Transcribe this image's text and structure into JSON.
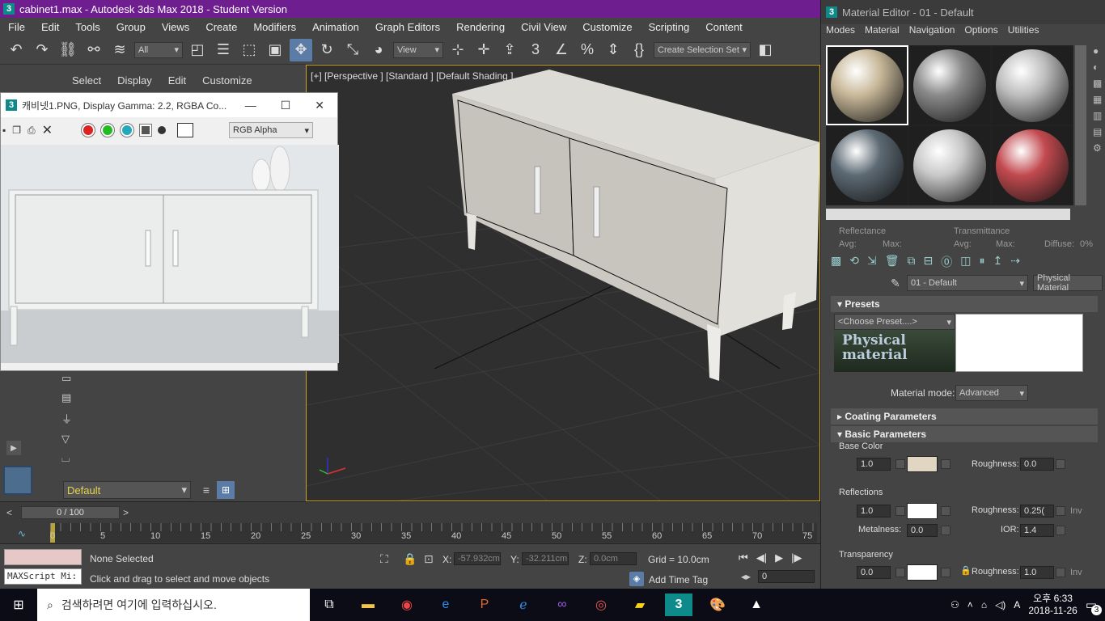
{
  "window": {
    "title": "cabinet1.max - Autodesk 3ds Max 2018 - Student Version"
  },
  "menubar": [
    "File",
    "Edit",
    "Tools",
    "Group",
    "Views",
    "Create",
    "Modifiers",
    "Animation",
    "Graph Editors",
    "Rendering",
    "Civil View",
    "Customize",
    "Scripting",
    "Content"
  ],
  "toolbar": {
    "filter": "All",
    "view": "View",
    "selection_set": "Create Selection Set"
  },
  "cmd_tabs": [
    "Select",
    "Display",
    "Edit",
    "Customize"
  ],
  "image_window": {
    "title": "캐비넷1.PNG, Display Gamma: 2.2, RGBA Co...",
    "channel": "RGB Alpha"
  },
  "viewport": {
    "label": "[+] [Perspective ] [Standard ] [Default Shading ]"
  },
  "layer": {
    "name": "Default"
  },
  "timeline": {
    "frame": "0 / 100",
    "ticks": [
      "0",
      "5",
      "10",
      "15",
      "20",
      "25",
      "30",
      "35",
      "40",
      "45",
      "50",
      "55",
      "60",
      "65",
      "70",
      "75"
    ]
  },
  "status": {
    "selection": "None Selected",
    "hint": "Click and drag to select and move objects",
    "maxscript": "MAXScript Mi:",
    "x_label": "X:",
    "x": "-57.932cm",
    "y_label": "Y:",
    "y": "-32.211cm",
    "z_label": "Z:",
    "z": "0.0cm",
    "grid": "Grid = 10.0cm",
    "add_time_tag": "Add Time Tag",
    "frame_field": "0"
  },
  "material_editor": {
    "title": "Material Editor - 01 - Default",
    "menu": [
      "Modes",
      "Material",
      "Navigation",
      "Options",
      "Utilities"
    ],
    "spheres": [
      "#c9b99a",
      "#8a8a8a",
      "#bdbdbd",
      "#5d6a74",
      "#c8c8c8",
      "#c24a4f"
    ],
    "reflectance": "Reflectance",
    "transmittance": "Transmittance",
    "avg": "Avg:",
    "max": "Max:",
    "diffuse": "Diffuse:",
    "diffuse_val": "0%",
    "material_name": "01 - Default",
    "material_type": "Physical Material",
    "presets_title": "Presets",
    "preset_choose": "<Choose Preset....>",
    "logo": "Physical material",
    "mode_label": "Material mode:",
    "mode_value": "Advanced",
    "coating_title": "Coating Parameters",
    "basic_title": "Basic Parameters",
    "base_color": "Base Color",
    "base_weight": "1.0",
    "base_swatch": "#e0d6c2",
    "roughness_label": "Roughness:",
    "base_roughness": "0.0",
    "reflections": "Reflections",
    "refl_weight": "1.0",
    "refl_roughness": "0.25(",
    "inv": "Inv",
    "metalness_label": "Metalness:",
    "metalness": "0.0",
    "ior_label": "IOR:",
    "ior": "1.4",
    "transparency": "Transparency",
    "trans_weight": "0.0",
    "trans_roughness": "1.0"
  },
  "taskbar": {
    "search": "검색하려면 여기에 입력하십시오.",
    "time": "오후 6:33",
    "date": "2018-11-26",
    "notifications": "3",
    "ime": "A"
  }
}
